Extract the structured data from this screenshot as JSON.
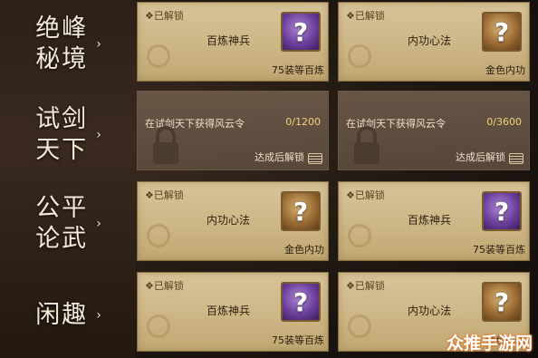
{
  "categories": [
    {
      "title_line1": "绝峰",
      "title_line2": "秘境",
      "arrow": "›"
    },
    {
      "title_line1": "试剑",
      "title_line2": "天下",
      "arrow": "›"
    },
    {
      "title_line1": "公平",
      "title_line2": "论武",
      "arrow": "›"
    },
    {
      "title_line1": "闲趣",
      "title_line2": "",
      "arrow": "›"
    }
  ],
  "cards": [
    {
      "status": "❖已解锁",
      "name": "百炼神兵",
      "icon": "question-purple",
      "tag": "75装等百炼"
    },
    {
      "status": "❖已解锁",
      "name": "内功心法",
      "icon": "question-gold",
      "tag": "金色内功"
    },
    {
      "requirement": "在试剑天下获得风云令",
      "progress": "0/1200",
      "note": "达成后解锁"
    },
    {
      "requirement": "在试剑天下获得风云令",
      "progress": "0/3600",
      "note": "达成后解锁"
    },
    {
      "status": "❖已解锁",
      "name": "内功心法",
      "icon": "question-gold",
      "tag": "金色内功"
    },
    {
      "status": "❖已解锁",
      "name": "百炼神兵",
      "icon": "question-purple",
      "tag": "75装等百炼"
    },
    {
      "status": "❖已解锁",
      "name": "百炼神兵",
      "icon": "question-purple",
      "tag": "75装等百炼"
    },
    {
      "status": "❖已解锁",
      "name": "内功心法",
      "icon": "question-gold",
      "tag": "金色内功"
    }
  ],
  "tile_glyph": "?",
  "watermark": "众推手游网",
  "colors": {
    "card_bg": "#cdb686",
    "locked_bg": "#5c4c3e",
    "progress": "#f2d07c",
    "purple_tile": "#6c3f9c",
    "gold_tile": "#9b6c34"
  }
}
